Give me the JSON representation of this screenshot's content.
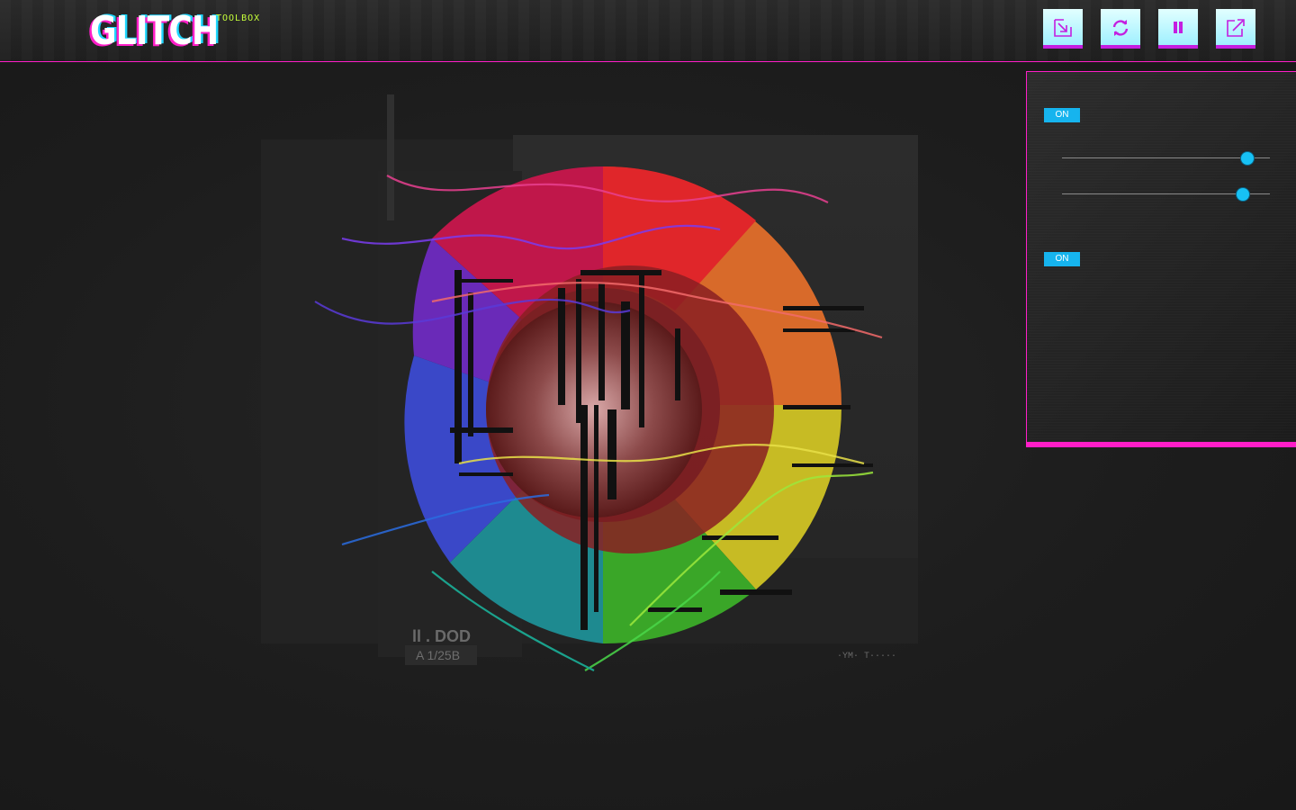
{
  "header": {
    "logo": "GLITCH",
    "logo_sub": "TOOLBOX",
    "buttons": [
      {
        "name": "import-button",
        "icon": "import-icon"
      },
      {
        "name": "refresh-button",
        "icon": "refresh-icon"
      },
      {
        "name": "pause-button",
        "icon": "pause-icon"
      },
      {
        "name": "export-button",
        "icon": "export-icon"
      }
    ]
  },
  "panel": {
    "toggle1": "ON",
    "slider1_value": 0.89,
    "slider2_value": 0.87,
    "toggle2": "ON"
  },
  "canvas": {
    "artwork_text_1": "ll . DOD",
    "artwork_text_2": "A 1/25B",
    "artwork_text_3": "·YM· T·····"
  },
  "colors": {
    "accent_magenta": "#ff1ec8",
    "accent_cyan": "#17c1f4",
    "logo_sub_green": "#c6ff3a",
    "button_face": "#bff7ff"
  }
}
